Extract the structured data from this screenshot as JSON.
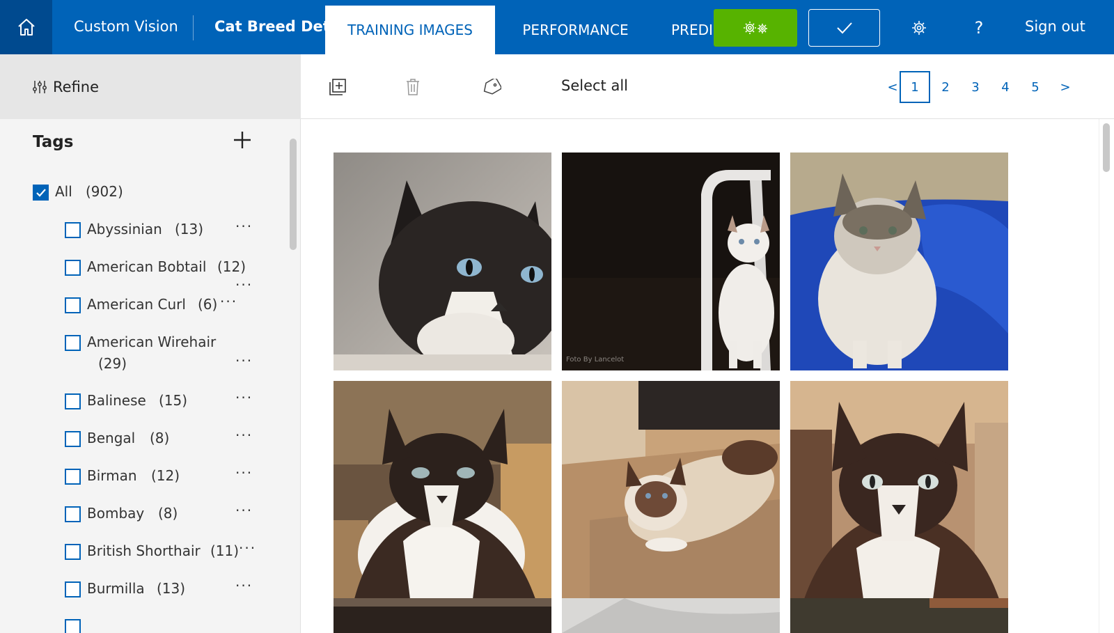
{
  "header": {
    "brand": "Custom Vision",
    "project_name": "Cat Breed Detector",
    "tabs": [
      {
        "label": "TRAINING IMAGES",
        "active": true
      },
      {
        "label": "PERFORMANCE",
        "active": false
      },
      {
        "label": "PREDICTIONS",
        "active": false
      }
    ],
    "sign_out": "Sign out",
    "help_glyph": "?",
    "icons": {
      "home": "home-icon",
      "train": "gears-icon",
      "quick_test": "checkmark-icon",
      "settings": "gear-icon",
      "help": "question-icon"
    },
    "colors": {
      "brand_blue": "#0063b8",
      "home_bg": "#004a8f",
      "train_green": "#57b300"
    }
  },
  "sidebar": {
    "refine_label": "Refine",
    "tags_title": "Tags",
    "all": {
      "label": "All",
      "count": "(902)",
      "checked": true
    },
    "tags": [
      {
        "name": "Abyssinian",
        "count": "(13)",
        "checked": false
      },
      {
        "name": "American Bobtail",
        "count": "(12)",
        "checked": false
      },
      {
        "name": "American Curl",
        "count": "(6)",
        "checked": false
      },
      {
        "name": "American Wirehair",
        "count": "(29)",
        "checked": false
      },
      {
        "name": "Balinese",
        "count": "(15)",
        "checked": false
      },
      {
        "name": "Bengal",
        "count": "(8)",
        "checked": false
      },
      {
        "name": "Birman",
        "count": "(12)",
        "checked": false
      },
      {
        "name": "Bombay",
        "count": "(8)",
        "checked": false
      },
      {
        "name": "British Shorthair",
        "count": "(11)",
        "checked": false
      },
      {
        "name": "Burmilla",
        "count": "(13)",
        "checked": false
      }
    ],
    "more_glyph": "···"
  },
  "toolbar": {
    "select_all": "Select all",
    "icons": [
      "add-images-icon",
      "trash-icon",
      "tag-icon"
    ],
    "pagination": {
      "prev": "<",
      "next": ">",
      "pages": [
        "1",
        "2",
        "3",
        "4",
        "5"
      ],
      "current": "1"
    }
  },
  "gallery": {
    "images": [
      {
        "name": "cat-image-1",
        "watermark": ""
      },
      {
        "name": "cat-image-2",
        "watermark": "Foto By Lancelot"
      },
      {
        "name": "cat-image-3",
        "watermark": ""
      },
      {
        "name": "cat-image-4",
        "watermark": ""
      },
      {
        "name": "cat-image-5",
        "watermark": ""
      },
      {
        "name": "cat-image-6",
        "watermark": ""
      }
    ]
  }
}
